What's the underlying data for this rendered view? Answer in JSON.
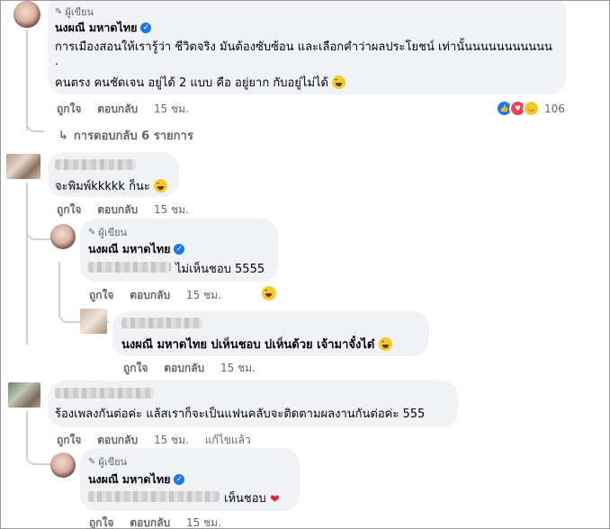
{
  "author_badge_label": "ผู้เขียน",
  "page_name": "นงผณี มหาดไทย",
  "like_label": "ถูกใจ",
  "reply_label": "ตอบกลับ",
  "comment1": {
    "line1": "การเมืองสอนให้เรารู้ว่า ชีวิตจริง มันต้องซับซ้อน และเลือกคำว่าผลประโยชน์ เท่านั้นนนนนนนนนนน",
    "line2": ".",
    "line3": "คนตรง คนชัดเจน อยู่ได้ 2 แบบ คือ อยู่ยาก กับอยู่ไม่ได้",
    "time": "15 ชม.",
    "reaction_count": "106",
    "replies_link": "การตอบกลับ 6 รายการ"
  },
  "comment2": {
    "text": "จะพิมพ์kkkkk ก็นะ",
    "time": "15 ชม.",
    "reply": {
      "text": "ไม่เห็นชอบ 5555",
      "time": "15 ชม."
    },
    "reply2": {
      "text": "นงผณี มหาดไทย บ่เห็นชอบ บ่เห็นด้วย เจ้ามาจั๋งได๋",
      "time": "15 ชม."
    }
  },
  "comment3": {
    "text": "ร้องเพลงกันต่อค่ะ แล้สเราก็จะเป็นแฟนคลับจะติดตามผลงานกันต่อค่ะ 555",
    "time": "15 ชม.",
    "edited": "แก้ไขแล้ว",
    "reply": {
      "text": "เห็นชอบ",
      "time": "15 ชม."
    }
  }
}
